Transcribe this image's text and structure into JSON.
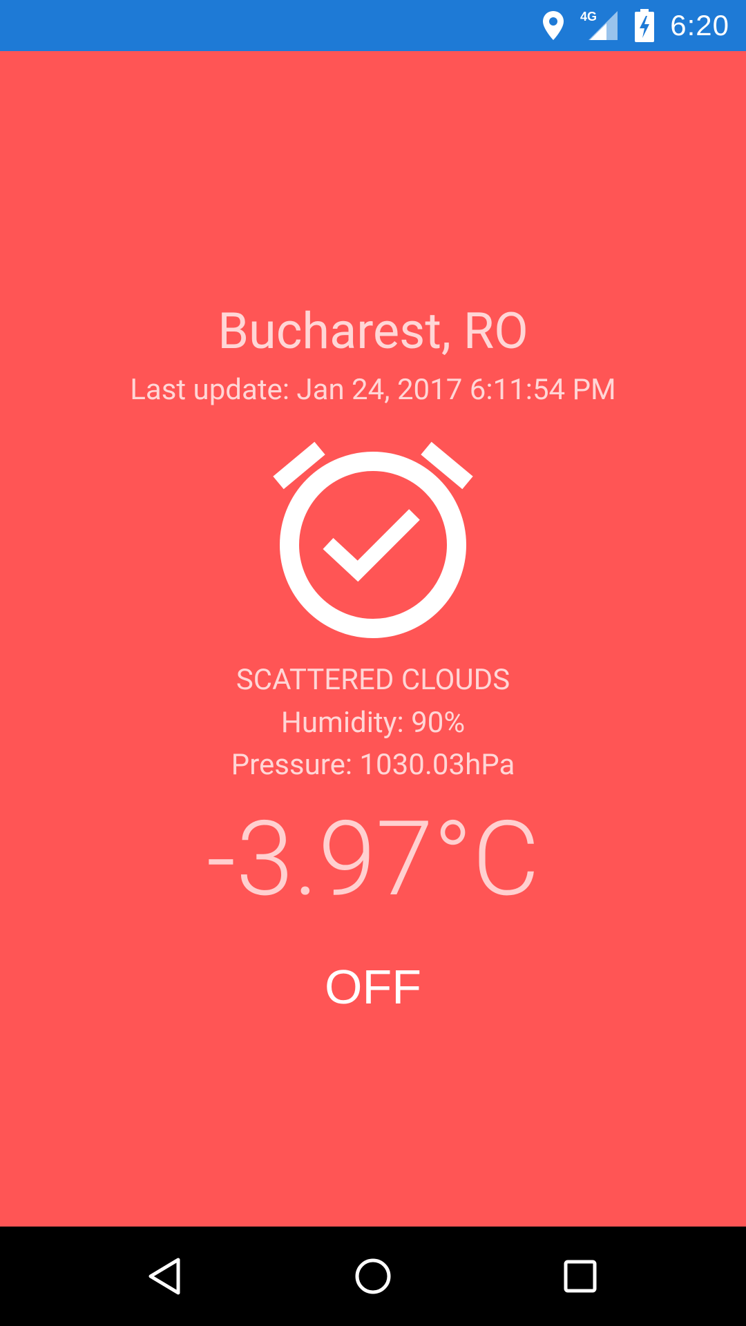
{
  "status_bar": {
    "time": "6:20",
    "network": "4G",
    "color": "#1E7AD6",
    "icons": [
      "location-icon",
      "signal-icon",
      "battery-charging-icon"
    ]
  },
  "weather": {
    "city": "Bucharest, RO",
    "last_update": "Last update: Jan 24, 2017 6:11:54 PM",
    "icon": "alarm-check-icon",
    "description": "SCATTERED CLOUDS",
    "humidity": "Humidity: 90%",
    "pressure": "Pressure: 1030.03hPa",
    "temperature": "-3.97°C"
  },
  "toggle": {
    "label": "OFF"
  },
  "theme": {
    "background": "#FF5555",
    "text": "#FFD6D6"
  },
  "nav_bar": {
    "buttons": [
      "back-icon",
      "home-icon",
      "recents-icon"
    ]
  }
}
